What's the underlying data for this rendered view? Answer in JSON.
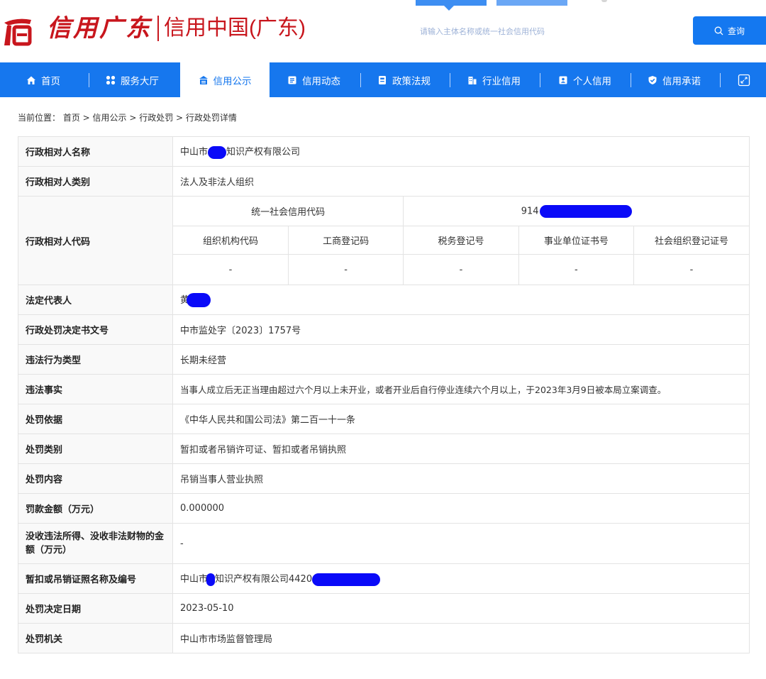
{
  "header": {
    "logo_text": "信用广东",
    "brand_title": "信用中国(广东)",
    "search_placeholder": "请输入主体名称或统一社会信用代码",
    "search_button": "查询",
    "colors": {
      "brand_red": "#c8161d",
      "nav_blue": "#1677ee",
      "button_blue": "#1478f0"
    }
  },
  "nav": {
    "items": [
      {
        "label": "首页",
        "icon": "home-icon"
      },
      {
        "label": "服务大厅",
        "icon": "grid-icon"
      },
      {
        "label": "信用公示",
        "icon": "notice-icon",
        "active": true
      },
      {
        "label": "信用动态",
        "icon": "news-icon"
      },
      {
        "label": "政策法规",
        "icon": "document-icon"
      },
      {
        "label": "行业信用",
        "icon": "building-icon"
      },
      {
        "label": "个人信用",
        "icon": "person-card-icon"
      },
      {
        "label": "信用承诺",
        "icon": "shield-check-icon"
      }
    ],
    "expand_icon": "expand-icon"
  },
  "breadcrumb": {
    "prefix": "当前位置：",
    "path": "首页 > 信用公示 > 行政处罚 > 行政处罚详情"
  },
  "detail": {
    "name_label": "行政相对人名称",
    "name_prefix": "中山市",
    "name_suffix": "知识产权有限公司",
    "category_label": "行政相对人类别",
    "category_value": "法人及非法人组织",
    "code_label": "行政相对人代码",
    "uscc_label": "统一社会信用代码",
    "uscc_prefix": "914",
    "code_headers": [
      "组织机构代码",
      "工商登记码",
      "税务登记号",
      "事业单位证书号",
      "社会组织登记证号"
    ],
    "code_values": [
      "-",
      "-",
      "-",
      "-",
      "-"
    ],
    "legal_rep_label": "法定代表人",
    "legal_rep_prefix": "黄",
    "decision_no_label": "行政处罚决定书文号",
    "decision_no_value": "中市监处字〔2023〕1757号",
    "violation_type_label": "违法行为类型",
    "violation_type_value": "长期未经营",
    "facts_label": "违法事实",
    "facts_value": "当事人成立后无正当理由超过六个月以上未开业，或者开业后自行停业连续六个月以上，于2023年3月9日被本局立案调查。",
    "basis_label": "处罚依据",
    "basis_value": "《中华人民共和国公司法》第二百一十一条",
    "penalty_cat_label": "处罚类别",
    "penalty_cat_value": "暂扣或者吊销许可证、暂扣或者吊销执照",
    "content_label": "处罚内容",
    "content_value": "吊销当事人营业执照",
    "fine_label": "罚款金额（万元）",
    "fine_value": "0.000000",
    "confiscation_label": "没收违法所得、没收非法财物的金额（万元）",
    "confiscation_value": "-",
    "license_label": "暂扣或吊销证照名称及编号",
    "license_prefix": "中山市",
    "license_middle": "知识产权有限公司4420",
    "date_label": "处罚决定日期",
    "date_value": "2023-05-10",
    "authority_label": "处罚机关",
    "authority_value": "中山市市场监督管理局"
  }
}
